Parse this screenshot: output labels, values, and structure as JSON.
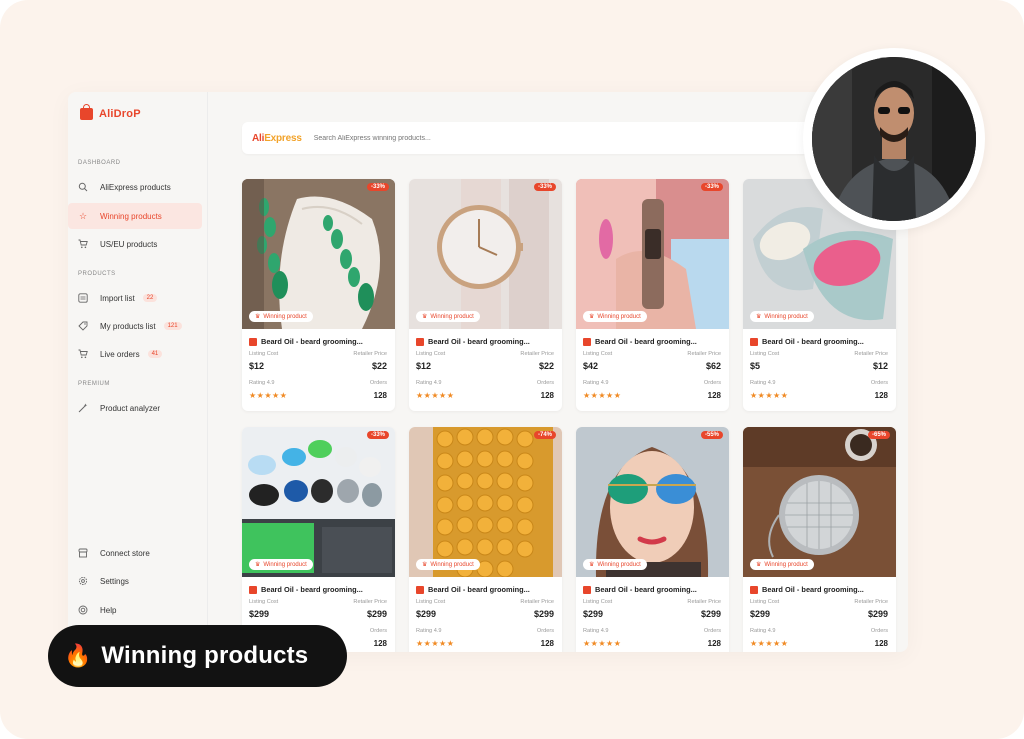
{
  "brand": {
    "name": "AliDroP"
  },
  "sidebar": {
    "section_dashboard": "DASHBOARD",
    "section_products": "PRODUCTS",
    "section_premium": "PREMIUM",
    "items": [
      {
        "label": "AliExpress products",
        "icon": "search-icon"
      },
      {
        "label": "Winning products",
        "icon": "star-icon",
        "active": true
      },
      {
        "label": "US/EU products",
        "icon": "cart-icon"
      },
      {
        "label": "Import list",
        "icon": "list-icon",
        "badge": "22"
      },
      {
        "label": "My products list",
        "icon": "tag-icon",
        "badge": "121"
      },
      {
        "label": "Live orders",
        "icon": "cart-icon",
        "badge": "41"
      },
      {
        "label": "Product analyzer",
        "icon": "magic-wand-icon"
      },
      {
        "label": "Connect store",
        "icon": "store-icon"
      },
      {
        "label": "Settings",
        "icon": "gear-icon"
      },
      {
        "label": "Help",
        "icon": "help-icon"
      }
    ]
  },
  "search": {
    "logo_main": "Ali",
    "logo_accent": "Express",
    "placeholder": "Search AliExpress winning products..."
  },
  "card_labels": {
    "winning": "Winning product",
    "listing_cost": "Listing Cost",
    "retailer_price": "Retailer Price",
    "rating": "Rating 4.9",
    "orders": "Orders",
    "stars": "★★★★★"
  },
  "products": [
    {
      "title": "Beard Oil - beard grooming...",
      "discount": "-33%",
      "cost": "$12",
      "retail": "$22",
      "orders": "128",
      "image": "emerald-earrings"
    },
    {
      "title": "Beard Oil - beard grooming...",
      "discount": "-33%",
      "cost": "$12",
      "retail": "$22",
      "orders": "128",
      "image": "rose-gold-watch"
    },
    {
      "title": "Beard Oil - beard grooming...",
      "discount": "-33%",
      "cost": "$42",
      "retail": "$62",
      "orders": "128",
      "image": "bracelet-watch"
    },
    {
      "title": "Beard Oil - beard grooming...",
      "discount": "",
      "cost": "$5",
      "retail": "$12",
      "orders": "128",
      "image": "soap-dish"
    },
    {
      "title": "Beard Oil - beard grooming...",
      "discount": "-33%",
      "cost": "$299",
      "retail": "$299",
      "orders": "128",
      "image": "mirror-covers"
    },
    {
      "title": "Beard Oil - beard grooming...",
      "discount": "-74%",
      "cost": "$299",
      "retail": "$299",
      "orders": "128",
      "image": "amber-beads"
    },
    {
      "title": "Beard Oil - beard grooming...",
      "discount": "-55%",
      "cost": "$299",
      "retail": "$299",
      "orders": "128",
      "image": "aviator-sunglasses"
    },
    {
      "title": "Beard Oil - beard grooming...",
      "discount": "-65%",
      "cost": "$299",
      "retail": "$299",
      "orders": "128",
      "image": "tea-infuser"
    }
  ],
  "banner": {
    "text": "Winning products",
    "emoji": "🔥"
  },
  "colors": {
    "accent": "#e8462b",
    "background": "#fcf3ec",
    "pill": "#121212"
  }
}
